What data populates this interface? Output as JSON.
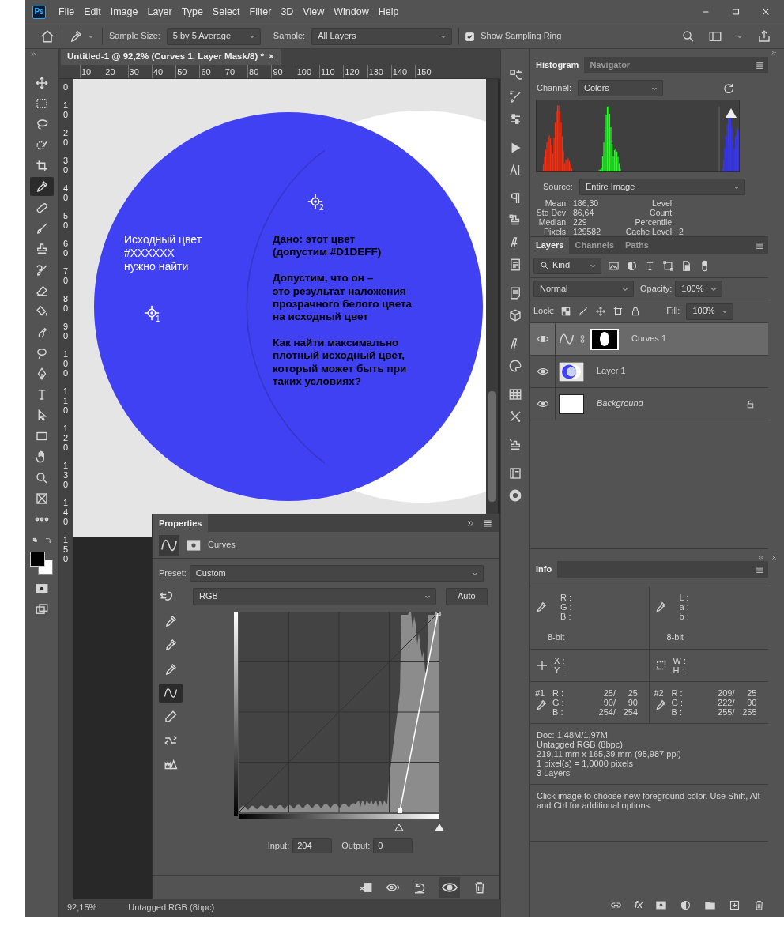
{
  "app": {
    "logo": "Ps",
    "menu": [
      "File",
      "Edit",
      "Image",
      "Layer",
      "Type",
      "Select",
      "Filter",
      "3D",
      "View",
      "Window",
      "Help"
    ]
  },
  "options_bar": {
    "sample_size_label": "Sample Size:",
    "sample_size": "5 by 5 Average",
    "sample_label": "Sample:",
    "sample": "All Layers",
    "sampling_ring": {
      "label": "Show Sampling Ring",
      "checked": true
    }
  },
  "tools": [
    {
      "kind": "move",
      "selected": false
    },
    {
      "kind": "marquee",
      "selected": false
    },
    {
      "kind": "lasso",
      "selected": false
    },
    {
      "kind": "quick-select",
      "selected": false
    },
    {
      "kind": "crop",
      "selected": false
    },
    {
      "kind": "eyedropper",
      "selected": true
    },
    {
      "kind": "bandage",
      "selected": false
    },
    {
      "kind": "brush",
      "selected": false
    },
    {
      "kind": "stamp",
      "selected": false
    },
    {
      "kind": "history-brush",
      "selected": false
    },
    {
      "kind": "eraser",
      "selected": false
    },
    {
      "kind": "bucket",
      "selected": false
    },
    {
      "kind": "smudge",
      "selected": false
    },
    {
      "kind": "dodge",
      "selected": false
    },
    {
      "kind": "pen",
      "selected": false
    },
    {
      "kind": "type",
      "selected": false
    },
    {
      "kind": "arrow",
      "selected": false
    },
    {
      "kind": "rectangle",
      "selected": false
    },
    {
      "kind": "hand",
      "selected": false
    },
    {
      "kind": "zoom",
      "selected": false
    },
    {
      "kind": "frame",
      "selected": false
    },
    {
      "kind": "more",
      "selected": false
    }
  ],
  "document": {
    "tab_title": "Untitled-1 @ 92,2% (Curves 1, Layer Mask/8) *",
    "tab_close": "×",
    "ruler_h": [
      "10",
      "20",
      "30",
      "40",
      "50",
      "60",
      "70",
      "80",
      "90",
      "100",
      "110",
      "120",
      "130",
      "140",
      "150"
    ],
    "ruler_v": [
      "0",
      "10",
      "20",
      "30",
      "40",
      "50",
      "60",
      "70",
      "80",
      "90",
      "100",
      "110",
      "120",
      "130",
      "140",
      "150"
    ],
    "left_text": "Исходный цвет\n#XXXXXX\nнужно найти",
    "right_paragraphs": [
      "Дано: этот цвет\n(допустим #D1DEFF)",
      "Допустим, что он –\nэто результат наложения\nпрозрачного белого цвета\nна исходный цвет",
      "Как найти максимально\nплотный исходный цвет,\nкоторый может быть при\nтаких условиях?"
    ],
    "samplers": [
      {
        "label": "1"
      },
      {
        "label": "2"
      }
    ]
  },
  "properties": {
    "title": "Properties",
    "type_label": "Curves",
    "preset_label": "Preset:",
    "preset": "Custom",
    "channel": "RGB",
    "auto": "Auto",
    "tools": [
      {
        "kind": "eyedropper-black",
        "selected": false
      },
      {
        "kind": "eyedropper-gray",
        "selected": false
      },
      {
        "kind": "eyedropper-white",
        "selected": false
      },
      {
        "kind": "curve-point",
        "selected": true
      },
      {
        "kind": "pencil",
        "selected": false
      },
      {
        "kind": "smooth",
        "selected": false
      },
      {
        "kind": "clipping-warning",
        "selected": false
      }
    ],
    "input_sliders": [
      {
        "level": 0.8
      },
      {
        "level": 1
      }
    ],
    "input_label": "Input:",
    "input": "204",
    "output_label": "Output:",
    "output": "0"
  },
  "histogram": {
    "tabs": [
      {
        "label": "Histogram",
        "selected": true
      },
      {
        "label": "Navigator",
        "selected": false
      }
    ],
    "channel_label": "Channel:",
    "channel": "Colors",
    "source_label": "Source:",
    "source": "Entire Image",
    "stats_left": [
      {
        "label": "Mean:",
        "value": "186,30"
      },
      {
        "label": "Std Dev:",
        "value": "86,64"
      },
      {
        "label": "Median:",
        "value": "229"
      },
      {
        "label": "Pixels:",
        "value": "129582"
      }
    ],
    "stats_right": [
      {
        "label": "Level:"
      },
      {
        "label": "Count:"
      },
      {
        "label": "Percentile:"
      },
      {
        "label": "Cache Level:",
        "value": "2"
      }
    ]
  },
  "layers": {
    "tabs": [
      {
        "label": "Layers",
        "selected": true
      },
      {
        "label": "Channels",
        "selected": false
      },
      {
        "label": "Paths",
        "selected": false
      }
    ],
    "filter": "Kind",
    "blend_mode": "Normal",
    "opacity_label": "Opacity:",
    "opacity": "100%",
    "lock_label": "Lock:",
    "fill_label": "Fill:",
    "fill": "100%",
    "items": [
      {
        "name": "Curves 1",
        "kind": "adjustment",
        "visible": true,
        "selected": true,
        "locked": false
      },
      {
        "name": "Layer 1",
        "kind": "pixel",
        "visible": true,
        "selected": false,
        "locked": false
      },
      {
        "name": "Background",
        "kind": "background",
        "visible": true,
        "selected": false,
        "locked": true
      }
    ],
    "footer_fx": "fx"
  },
  "info": {
    "tabs": [
      {
        "label": "Info",
        "selected": true
      }
    ],
    "readouts": [
      {
        "labels": [
          "R :",
          "G :",
          "B :"
        ],
        "mode": "8-bit"
      },
      {
        "labels": [
          "L :",
          "a :",
          "b :"
        ],
        "mode": "8-bit"
      }
    ],
    "position_labels": [
      "X :",
      "Y :"
    ],
    "size_labels": [
      "W :",
      "H :"
    ],
    "samplers": [
      {
        "id": "#1",
        "rows": [
          {
            "label": "R :",
            "before": "25/",
            "after": "25"
          },
          {
            "label": "G :",
            "before": "90/",
            "after": "90"
          },
          {
            "label": "B :",
            "before": "254/",
            "after": "254"
          }
        ]
      },
      {
        "id": "#2",
        "rows": [
          {
            "label": "R :",
            "before": "209/",
            "after": "25"
          },
          {
            "label": "G :",
            "before": "222/",
            "after": "90"
          },
          {
            "label": "B :",
            "before": "255/",
            "after": "255"
          }
        ]
      }
    ],
    "doc_lines": [
      "Doc: 1,48M/1,97M",
      "Untagged RGB (8bpc)",
      "219,11 mm x 165,39 mm (95,987 ppi)",
      "1 pixel(s) = 1,0000 pixels",
      "3 Layers"
    ],
    "hint": "Click image to choose new foreground color.  Use Shift, Alt and Ctrl for additional options."
  },
  "status_bar": {
    "zoom": "92,15%",
    "doc_info": "Untagged RGB (8bpc)"
  }
}
